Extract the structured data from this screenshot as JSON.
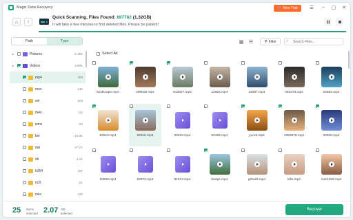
{
  "app": {
    "title": "Magic Data Recovery",
    "new_trial": "New Trial"
  },
  "scan": {
    "title_prefix": "Quick Scanning, Files Found: ",
    "count": "897782",
    "size": " (1.32GB)",
    "subtitle": "It will take a few minutes to find deleted files. Please be patient!",
    "progress": 1.0
  },
  "left_panel": {
    "tabs": [
      "Path",
      "Type"
    ],
    "active_tab": "Type",
    "tree": [
      {
        "label": "Pictures",
        "size": "5.49K",
        "level": 0,
        "icon": "image-icon",
        "checked": false,
        "selected": false
      },
      {
        "label": "Videos",
        "size": "3.98K",
        "level": 0,
        "icon": "video-icon",
        "checked": true,
        "selected": false
      },
      {
        "label": "mp4",
        "size": "389",
        "level": 1,
        "icon": "folder-icon",
        "checked": true,
        "selected": true
      },
      {
        "label": "mov",
        "size": "242",
        "level": 1,
        "icon": "folder-icon",
        "checked": false,
        "selected": false
      },
      {
        "label": "avi",
        "size": "828",
        "level": 1,
        "icon": "folder-icon",
        "checked": false,
        "selected": false
      },
      {
        "label": "m4v",
        "size": "112",
        "level": 1,
        "icon": "folder-icon",
        "checked": false,
        "selected": false
      },
      {
        "label": "wmv",
        "size": "60",
        "level": 1,
        "icon": "folder-icon",
        "checked": false,
        "selected": false
      },
      {
        "label": "bin",
        "size": "10.8K",
        "level": 1,
        "icon": "folder-icon",
        "checked": false,
        "selected": false
      },
      {
        "label": "dat",
        "size": "27.7K",
        "level": 1,
        "icon": "folder-icon",
        "checked": false,
        "selected": false
      },
      {
        "label": "dir",
        "size": "3.2K",
        "level": 1,
        "icon": "folder-icon",
        "checked": false,
        "selected": false
      },
      {
        "label": "h264",
        "size": "157",
        "level": 1,
        "icon": "folder-icon",
        "checked": false,
        "selected": false
      },
      {
        "label": "m2t",
        "size": "81",
        "level": 1,
        "icon": "folder-icon",
        "checked": false,
        "selected": false
      },
      {
        "label": "mkv",
        "size": "240",
        "level": 1,
        "icon": "folder-icon",
        "checked": false,
        "selected": false
      }
    ]
  },
  "toolbar": {
    "filter_label": "Filter",
    "search_placeholder": "Search Files..."
  },
  "grid": {
    "select_all": "Select All",
    "files": [
      {
        "name": "landscape.mp4",
        "checked": false,
        "thumb": "photo",
        "colors": [
          "#7fb0d8",
          "#3d6a3a"
        ]
      },
      {
        "name": "298029.mp4",
        "checked": true,
        "thumb": "photo",
        "colors": [
          "#4d3a30",
          "#a37a5a"
        ]
      },
      {
        "name": "910827.mp4",
        "checked": true,
        "thumb": "photo",
        "colors": [
          "#b9c9d6",
          "#6a7b62"
        ]
      },
      {
        "name": "12902.mp4",
        "checked": false,
        "thumb": "photo",
        "colors": [
          "#c4b7a8",
          "#6b5a4c"
        ]
      },
      {
        "name": "19287.mp4",
        "checked": false,
        "thumb": "photo",
        "colors": [
          "#8fb3cf",
          "#2d4d6d"
        ]
      },
      {
        "name": "092373.mp4",
        "checked": false,
        "thumb": "photo",
        "colors": [
          "#2b2b2b",
          "#7a6a5e"
        ]
      },
      {
        "name": "02883.mp4",
        "checked": false,
        "thumb": "photo",
        "colors": [
          "#1c3d5a",
          "#4fa3c7"
        ]
      },
      {
        "name": "82910.mp4",
        "checked": true,
        "thumb": "photo",
        "colors": [
          "#f0e6d5",
          "#d98a2b"
        ]
      },
      {
        "name": "82910.mp4",
        "checked": false,
        "thumb": "photo",
        "colors": [
          "#a9c4dd",
          "#8a6a5a"
        ],
        "selected": true
      },
      {
        "name": "20483.mp4",
        "checked": false,
        "thumb": "video"
      },
      {
        "name": "20483.mp4",
        "checked": false,
        "thumb": "video"
      },
      {
        "name": "yure8.mp4",
        "checked": true,
        "thumb": "photo",
        "colors": [
          "#f4a64a",
          "#8a4c12"
        ]
      },
      {
        "name": "1093878.mp4",
        "checked": true,
        "thumb": "photo",
        "colors": [
          "#6b5a4a",
          "#e8b27a"
        ]
      },
      {
        "name": "20928.mp4",
        "checked": true,
        "thumb": "photo",
        "colors": [
          "#2a3a7a",
          "#6f8fd8"
        ]
      },
      {
        "name": "10928.mp4",
        "checked": false,
        "thumb": "video"
      },
      {
        "name": "82872.mp4",
        "checked": false,
        "thumb": "video"
      },
      {
        "name": "91873.mp4",
        "checked": false,
        "thumb": "video"
      },
      {
        "name": "bridge.mp4",
        "checked": true,
        "thumb": "photo",
        "colors": [
          "#9cc7e0",
          "#3f6e3a"
        ]
      },
      {
        "name": "girlwell.mp4",
        "checked": false,
        "thumb": "photo",
        "colors": [
          "#d9e3e8",
          "#b58f78"
        ]
      },
      {
        "name": "killo.mp4",
        "checked": false,
        "thumb": "photo",
        "colors": [
          "#e9d2c2",
          "#c89a80"
        ]
      },
      {
        "name": "rure1289.mp4",
        "checked": false,
        "thumb": "photo",
        "colors": [
          "#f1c9a8",
          "#8a5a40"
        ]
      }
    ]
  },
  "footer": {
    "items_count": "25",
    "items_label": "Items",
    "items_sub": "selected",
    "size_value": "2.07",
    "size_unit": "GB",
    "size_sub": "selected",
    "recover_label": "Recover"
  },
  "colors": {
    "accent": "#1f9e74",
    "trial": "#ff6b2c"
  }
}
